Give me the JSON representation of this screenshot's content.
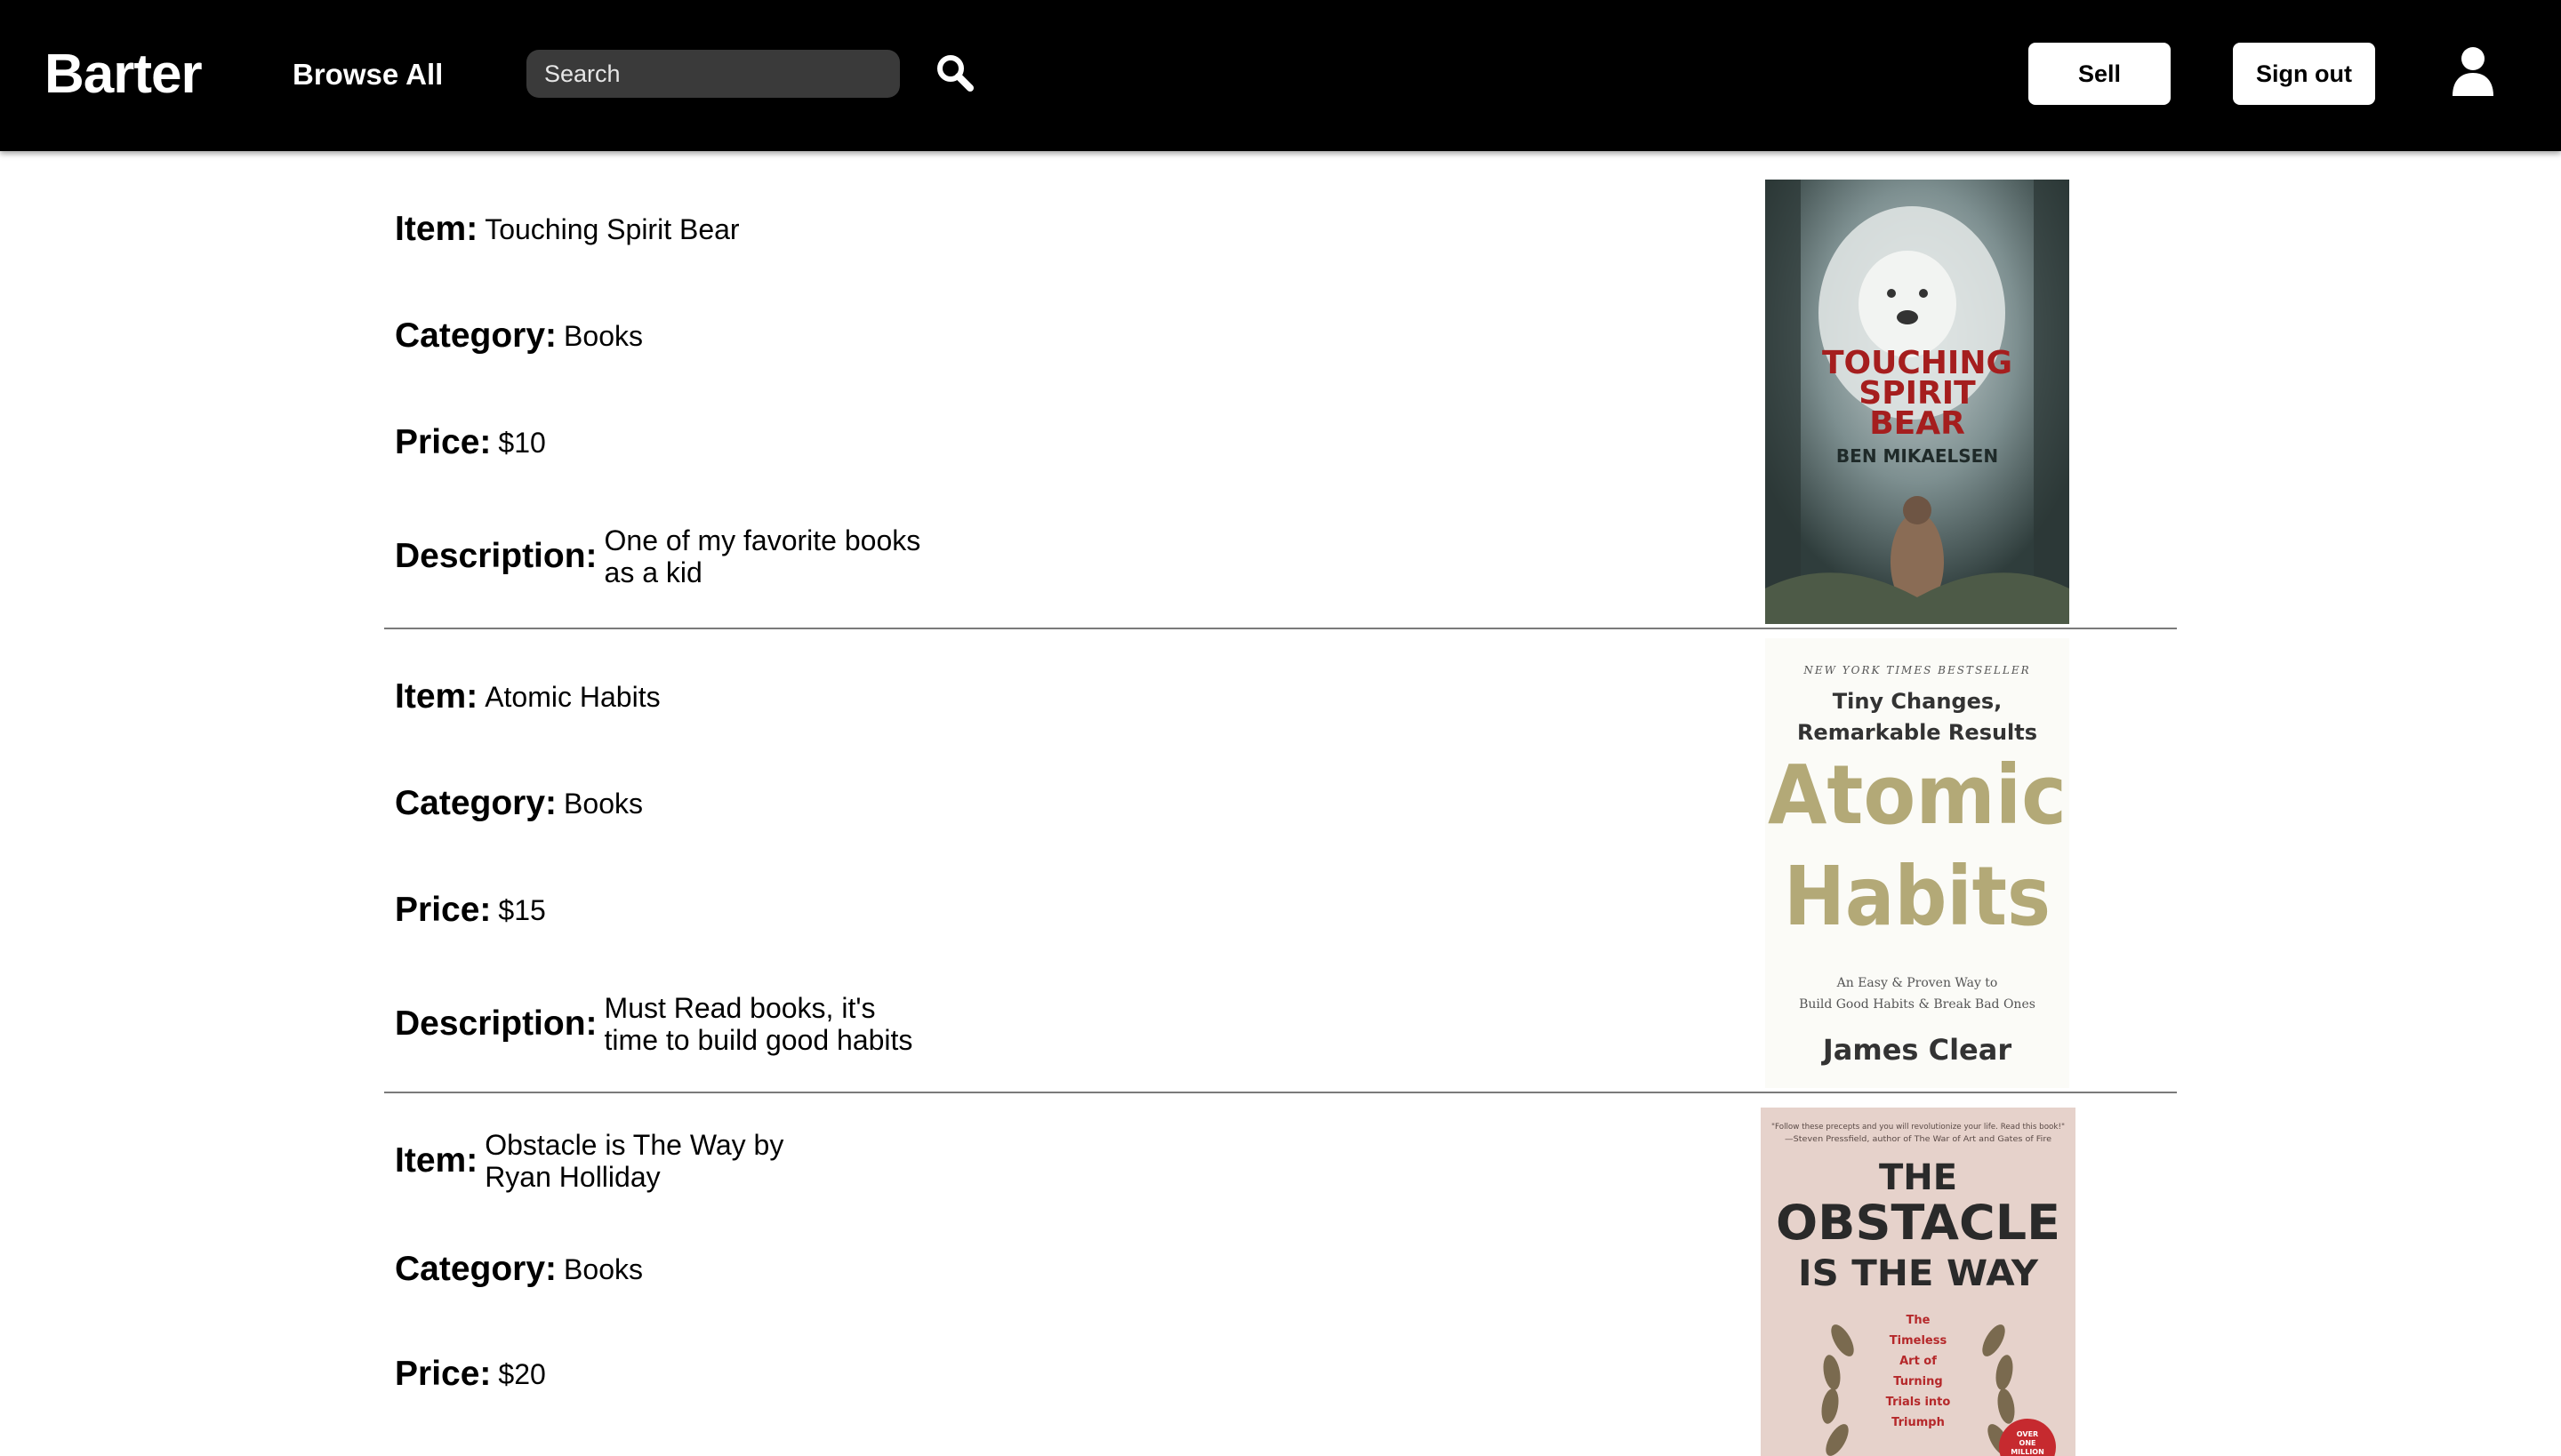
{
  "app": {
    "brand": "Barter",
    "nav": {
      "browse_all": "Browse All"
    },
    "search": {
      "placeholder": "Search",
      "value": ""
    },
    "buttons": {
      "sell": "Sell",
      "sign_out": "Sign out"
    },
    "icons": {
      "search": "search-icon",
      "user": "user-icon"
    },
    "colors": {
      "navbar": "#000000",
      "button_bg": "#ffffff",
      "divider": "#7a7a7a"
    }
  },
  "labels": {
    "item": "Item:",
    "category": "Category:",
    "price": "Price:",
    "description": "Description:"
  },
  "listings": [
    {
      "item": "Touching Spirit Bear",
      "category": "Books",
      "price": "$10",
      "description": "One of my favorite books\nas a kid",
      "cover": {
        "title_lines": [
          "TOUCHING",
          "SPIRIT",
          "BEAR"
        ],
        "author": "BEN MIKAELSEN"
      }
    },
    {
      "item": "Atomic Habits",
      "category": "Books",
      "price": "$15",
      "description": "Must Read books, it's\ntime to build good habits",
      "cover": {
        "banner": "NEW YORK TIMES BESTSELLER",
        "tagline_1": "Tiny Changes,",
        "tagline_2": "Remarkable Results",
        "title_1": "Atomic",
        "title_2": "Habits",
        "subtitle_1": "An Easy & Proven Way to",
        "subtitle_2": "Build Good Habits & Break Bad Ones",
        "author": "James Clear"
      }
    },
    {
      "item": "Obstacle is The Way by\nRyan Holliday",
      "category": "Books",
      "price": "$20",
      "description": "",
      "cover": {
        "quote_1": "\"Follow these precepts and you will revolutionize your life. Read this book!\"",
        "quote_2": "—Steven Pressfield, author of The War of Art and Gates of Fire",
        "title_1": "THE",
        "title_2": "OBSTACLE",
        "title_3": "IS THE WAY",
        "subtitle": [
          "The",
          "Timeless",
          "Art of",
          "Turning",
          "Trials into",
          "Triumph"
        ],
        "badge": [
          "OVER",
          "ONE",
          "MILLION"
        ]
      }
    }
  ]
}
